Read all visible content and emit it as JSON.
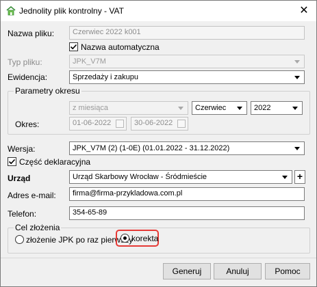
{
  "window": {
    "title": "Jednolity plik kontrolny - VAT",
    "close_symbol": "✕"
  },
  "file_name": {
    "label": "Nazwa pliku:",
    "value": "Czerwiec 2022 k001"
  },
  "auto_name": {
    "label": "Nazwa automatyczna",
    "checked": true
  },
  "file_type": {
    "label": "Typ pliku:",
    "value": "JPK_V7M"
  },
  "register": {
    "label": "Ewidencja:",
    "value": "Sprzedaży i zakupu"
  },
  "period_params": {
    "legend": "Parametry okresu",
    "mode": "z miesiąca",
    "month": "Czerwiec",
    "year": "2022",
    "period_label": "Okres:",
    "date_from": "01-06-2022",
    "date_to": "30-06-2022"
  },
  "version": {
    "label": "Wersja:",
    "value": "JPK_V7M (2) (1-0E) (01.01.2022 - 31.12.2022)"
  },
  "declaration_part": {
    "label": "Część deklaracyjna",
    "checked": true
  },
  "office": {
    "label": "Urząd",
    "value": "Urząd Skarbowy Wrocław - Śródmieście",
    "add_symbol": "+"
  },
  "email": {
    "label": "Adres e-mail:",
    "value": "firma@firma-przykladowa.com.pl"
  },
  "phone": {
    "label": "Telefon:",
    "value": "354-65-89"
  },
  "purpose": {
    "legend": "Cel złożenia",
    "option_first": "złożenie JPK po raz pierwszy",
    "option_correction": "korekta",
    "selected": "korekta"
  },
  "buttons": {
    "generate": "Generuj",
    "cancel": "Anuluj",
    "help": "Pomoc"
  },
  "colors": {
    "highlight": "#e53935",
    "icon_green": "#3c8f3c"
  }
}
